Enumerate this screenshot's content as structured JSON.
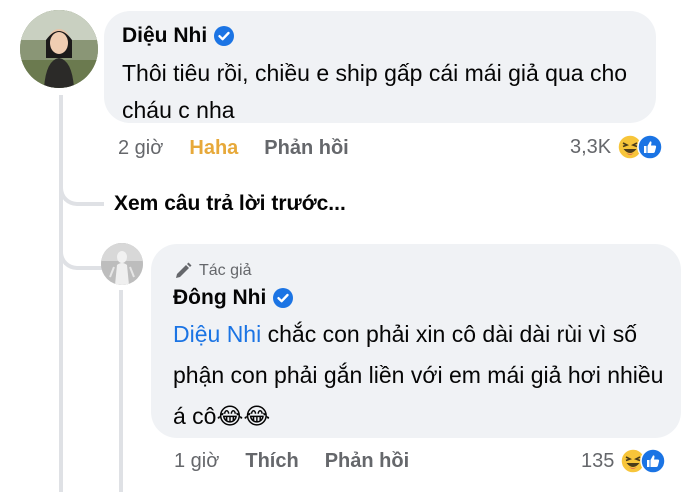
{
  "comment1": {
    "author": "Diệu Nhi",
    "text": "Thôi tiêu rồi, chiều e ship gấp cái mái giả qua cho cháu c nha",
    "time": "2 giờ",
    "reacted_label": "Haha",
    "reply_label": "Phản hồi",
    "reaction_count": "3,3K"
  },
  "see_previous": "Xem câu trả lời trước...",
  "comment2": {
    "badge": "Tác giả",
    "author": "Đông Nhi",
    "mention": "Diệu Nhi",
    "text": " chắc con phải xin cô dài dài rùi vì số phận con phải gắn liền với em mái giả hơi nhiều á cô",
    "emoji": "😂😂",
    "time": "1 giờ",
    "like_label": "Thích",
    "reply_label": "Phản hồi",
    "reaction_count": "135"
  },
  "colors": {
    "bubble": "#f0f2f5",
    "verified": "#1b74e4",
    "haha": "#e7a93a",
    "meta": "#65676b"
  },
  "icons": [
    "verified-badge-icon",
    "pen-icon",
    "haha-reaction-icon",
    "like-reaction-icon"
  ]
}
